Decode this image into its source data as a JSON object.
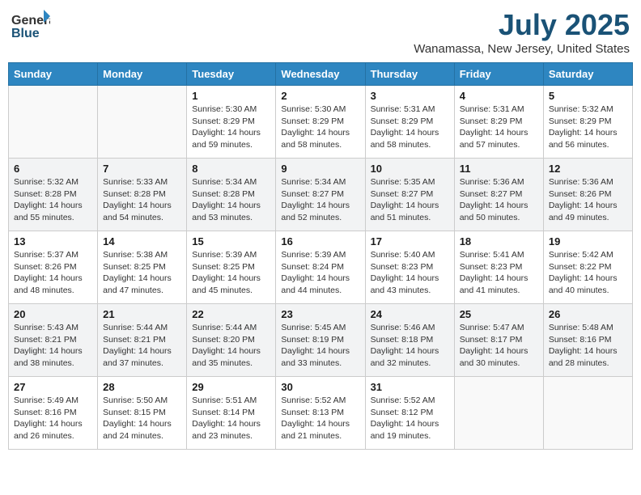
{
  "header": {
    "logo_general": "General",
    "logo_blue": "Blue",
    "title": "July 2025",
    "subtitle": "Wanamassa, New Jersey, United States"
  },
  "weekdays": [
    "Sunday",
    "Monday",
    "Tuesday",
    "Wednesday",
    "Thursday",
    "Friday",
    "Saturday"
  ],
  "weeks": [
    [
      {
        "day": "",
        "info": ""
      },
      {
        "day": "",
        "info": ""
      },
      {
        "day": "1",
        "info": "Sunrise: 5:30 AM\nSunset: 8:29 PM\nDaylight: 14 hours and 59 minutes."
      },
      {
        "day": "2",
        "info": "Sunrise: 5:30 AM\nSunset: 8:29 PM\nDaylight: 14 hours and 58 minutes."
      },
      {
        "day": "3",
        "info": "Sunrise: 5:31 AM\nSunset: 8:29 PM\nDaylight: 14 hours and 58 minutes."
      },
      {
        "day": "4",
        "info": "Sunrise: 5:31 AM\nSunset: 8:29 PM\nDaylight: 14 hours and 57 minutes."
      },
      {
        "day": "5",
        "info": "Sunrise: 5:32 AM\nSunset: 8:29 PM\nDaylight: 14 hours and 56 minutes."
      }
    ],
    [
      {
        "day": "6",
        "info": "Sunrise: 5:32 AM\nSunset: 8:28 PM\nDaylight: 14 hours and 55 minutes."
      },
      {
        "day": "7",
        "info": "Sunrise: 5:33 AM\nSunset: 8:28 PM\nDaylight: 14 hours and 54 minutes."
      },
      {
        "day": "8",
        "info": "Sunrise: 5:34 AM\nSunset: 8:28 PM\nDaylight: 14 hours and 53 minutes."
      },
      {
        "day": "9",
        "info": "Sunrise: 5:34 AM\nSunset: 8:27 PM\nDaylight: 14 hours and 52 minutes."
      },
      {
        "day": "10",
        "info": "Sunrise: 5:35 AM\nSunset: 8:27 PM\nDaylight: 14 hours and 51 minutes."
      },
      {
        "day": "11",
        "info": "Sunrise: 5:36 AM\nSunset: 8:27 PM\nDaylight: 14 hours and 50 minutes."
      },
      {
        "day": "12",
        "info": "Sunrise: 5:36 AM\nSunset: 8:26 PM\nDaylight: 14 hours and 49 minutes."
      }
    ],
    [
      {
        "day": "13",
        "info": "Sunrise: 5:37 AM\nSunset: 8:26 PM\nDaylight: 14 hours and 48 minutes."
      },
      {
        "day": "14",
        "info": "Sunrise: 5:38 AM\nSunset: 8:25 PM\nDaylight: 14 hours and 47 minutes."
      },
      {
        "day": "15",
        "info": "Sunrise: 5:39 AM\nSunset: 8:25 PM\nDaylight: 14 hours and 45 minutes."
      },
      {
        "day": "16",
        "info": "Sunrise: 5:39 AM\nSunset: 8:24 PM\nDaylight: 14 hours and 44 minutes."
      },
      {
        "day": "17",
        "info": "Sunrise: 5:40 AM\nSunset: 8:23 PM\nDaylight: 14 hours and 43 minutes."
      },
      {
        "day": "18",
        "info": "Sunrise: 5:41 AM\nSunset: 8:23 PM\nDaylight: 14 hours and 41 minutes."
      },
      {
        "day": "19",
        "info": "Sunrise: 5:42 AM\nSunset: 8:22 PM\nDaylight: 14 hours and 40 minutes."
      }
    ],
    [
      {
        "day": "20",
        "info": "Sunrise: 5:43 AM\nSunset: 8:21 PM\nDaylight: 14 hours and 38 minutes."
      },
      {
        "day": "21",
        "info": "Sunrise: 5:44 AM\nSunset: 8:21 PM\nDaylight: 14 hours and 37 minutes."
      },
      {
        "day": "22",
        "info": "Sunrise: 5:44 AM\nSunset: 8:20 PM\nDaylight: 14 hours and 35 minutes."
      },
      {
        "day": "23",
        "info": "Sunrise: 5:45 AM\nSunset: 8:19 PM\nDaylight: 14 hours and 33 minutes."
      },
      {
        "day": "24",
        "info": "Sunrise: 5:46 AM\nSunset: 8:18 PM\nDaylight: 14 hours and 32 minutes."
      },
      {
        "day": "25",
        "info": "Sunrise: 5:47 AM\nSunset: 8:17 PM\nDaylight: 14 hours and 30 minutes."
      },
      {
        "day": "26",
        "info": "Sunrise: 5:48 AM\nSunset: 8:16 PM\nDaylight: 14 hours and 28 minutes."
      }
    ],
    [
      {
        "day": "27",
        "info": "Sunrise: 5:49 AM\nSunset: 8:16 PM\nDaylight: 14 hours and 26 minutes."
      },
      {
        "day": "28",
        "info": "Sunrise: 5:50 AM\nSunset: 8:15 PM\nDaylight: 14 hours and 24 minutes."
      },
      {
        "day": "29",
        "info": "Sunrise: 5:51 AM\nSunset: 8:14 PM\nDaylight: 14 hours and 23 minutes."
      },
      {
        "day": "30",
        "info": "Sunrise: 5:52 AM\nSunset: 8:13 PM\nDaylight: 14 hours and 21 minutes."
      },
      {
        "day": "31",
        "info": "Sunrise: 5:52 AM\nSunset: 8:12 PM\nDaylight: 14 hours and 19 minutes."
      },
      {
        "day": "",
        "info": ""
      },
      {
        "day": "",
        "info": ""
      }
    ]
  ]
}
